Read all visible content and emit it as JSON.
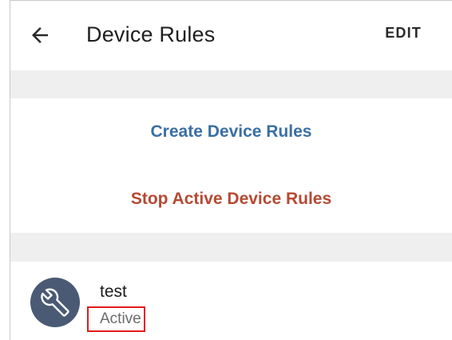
{
  "appbar": {
    "title": "Device Rules",
    "edit_label": "EDIT",
    "back_icon": "arrow-left-icon"
  },
  "actions": {
    "create_label": "Create Device Rules",
    "stop_label": "Stop Active Device Rules",
    "create_color": "#3a6fa5",
    "stop_color": "#b54a33"
  },
  "rules": [
    {
      "name": "test",
      "status": "Active",
      "icon": "wrench-icon",
      "status_highlighted": true,
      "highlight_color": "#e31b1b"
    }
  ]
}
